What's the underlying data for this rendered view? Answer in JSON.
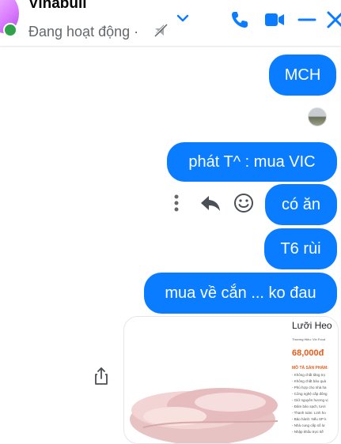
{
  "header": {
    "contact_name": "Vinabull",
    "status": "Đang hoạt động ·",
    "icons": [
      "mute-icon",
      "chevron-down-icon",
      "phone-icon",
      "video-call-icon",
      "minimize-icon",
      "close-icon"
    ],
    "online_color": "#31a24c"
  },
  "messages": [
    {
      "text": "MCH",
      "sender": "me"
    },
    {
      "text": "phát T^ : mua VIC",
      "sender": "me"
    },
    {
      "text": "có ăn",
      "sender": "me"
    },
    {
      "text": "T6 rùi",
      "sender": "me"
    },
    {
      "text": "mua về cắn ... ko đau",
      "sender": "me"
    }
  ],
  "message_actions": [
    "more-options-icon",
    "reply-icon",
    "react-icon"
  ],
  "shared_product": {
    "title": "Lưỡi Heo",
    "brand": "Thương Hiệu: Vin Food",
    "price": "68,000đ",
    "description_heading": "MÔ TẢ SẢN PHẨM:",
    "description_lines": [
      "- Không chất tăng trọ",
      "- Không chất bảo quả",
      "- Phù hợp cho nhà ha",
      "- Công nghệ cấp đông",
      "- Giữ nguyên hương vị",
      "- Đảm bảo sạch, tươi",
      "- Thanh toán: Linh ho",
      "- Bảo hành: Nếu SP k",
      "- Nhà cung cấp số lư",
      "- Nhập khẩu trực tiế"
    ]
  },
  "colors": {
    "bubble": "#0a7cff",
    "bubble_text": "#ffffff",
    "accent_icon": "#0a7cff",
    "price": "#e85b1a"
  }
}
